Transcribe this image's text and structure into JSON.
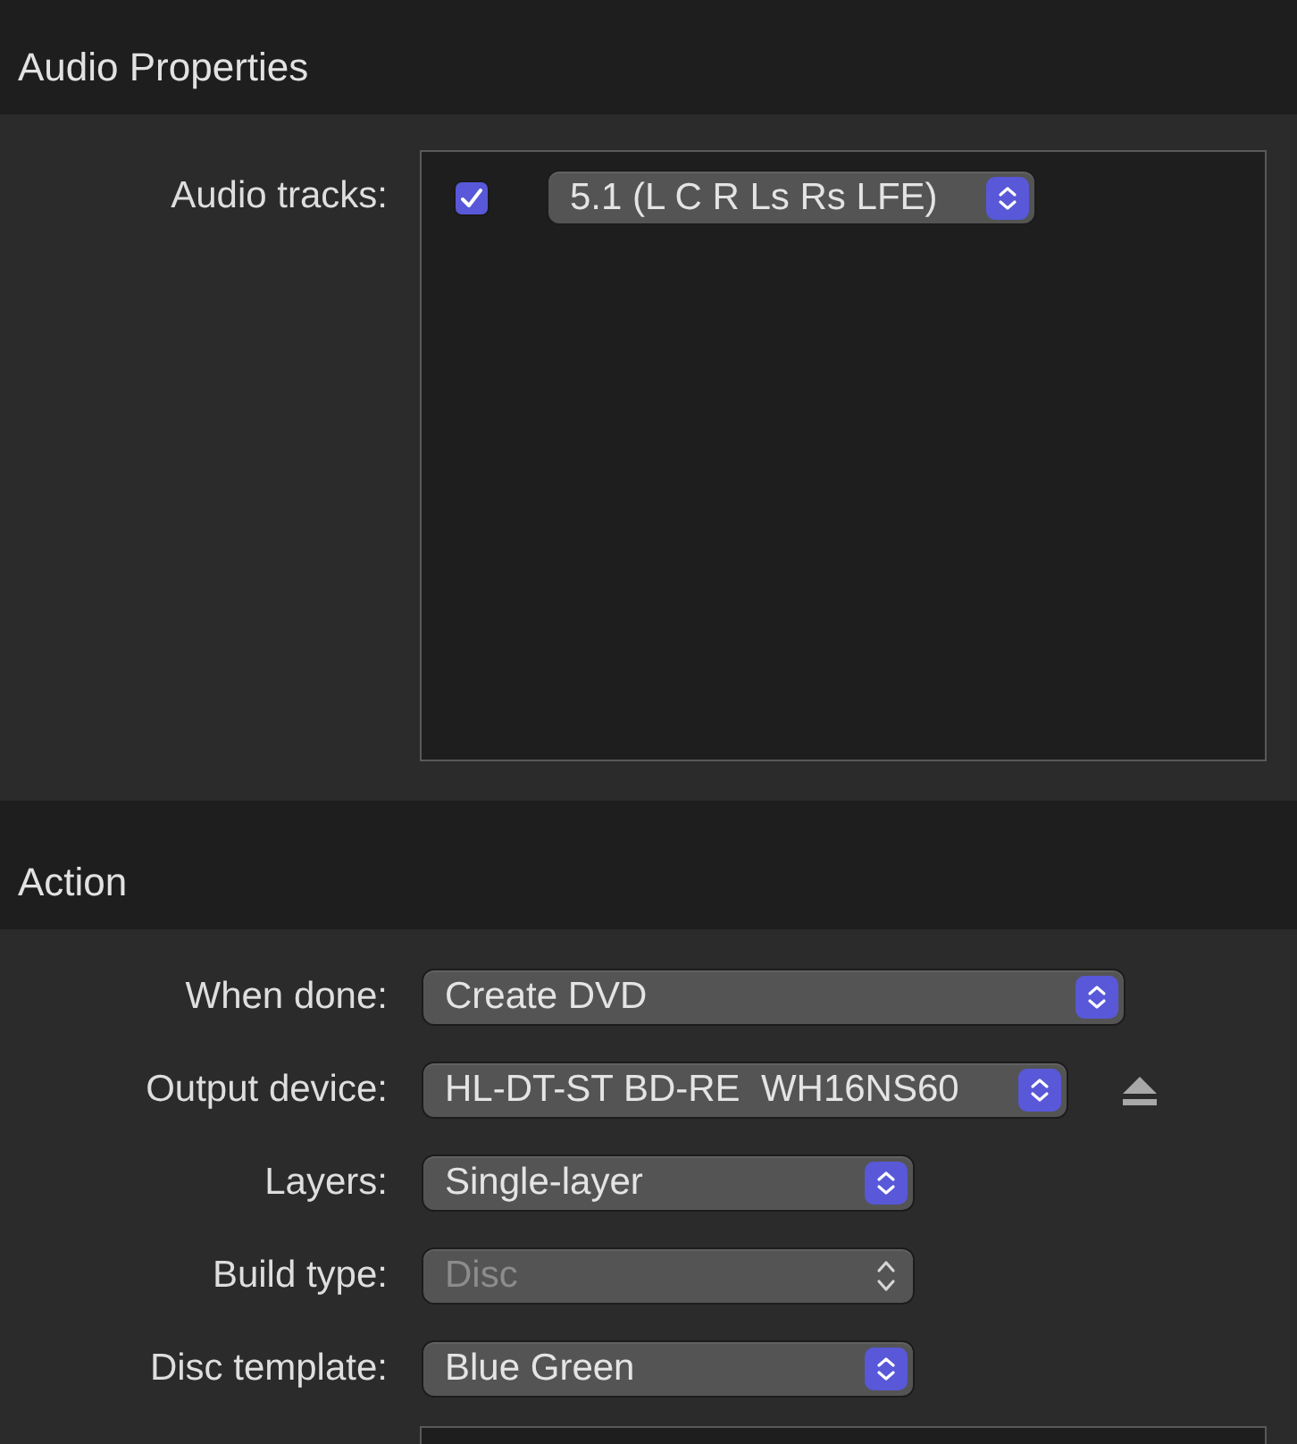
{
  "audio_properties": {
    "title": "Audio Properties",
    "label": "Audio tracks:",
    "tracks": [
      {
        "checked": true,
        "format": "5.1 (L C R Ls Rs LFE)"
      }
    ]
  },
  "action": {
    "title": "Action",
    "fields": [
      {
        "label": "When done:",
        "value": "Create DVD",
        "disabled": false,
        "eject": false
      },
      {
        "label": "Output device:",
        "value": "HL-DT-ST BD-RE  WH16NS60",
        "disabled": false,
        "eject": true
      },
      {
        "label": "Layers:",
        "value": "Single-layer",
        "disabled": false,
        "eject": false
      },
      {
        "label": "Build type:",
        "value": "Disc",
        "disabled": true,
        "eject": false
      },
      {
        "label": "Disc template:",
        "value": "Blue Green",
        "disabled": false,
        "eject": false
      }
    ]
  }
}
